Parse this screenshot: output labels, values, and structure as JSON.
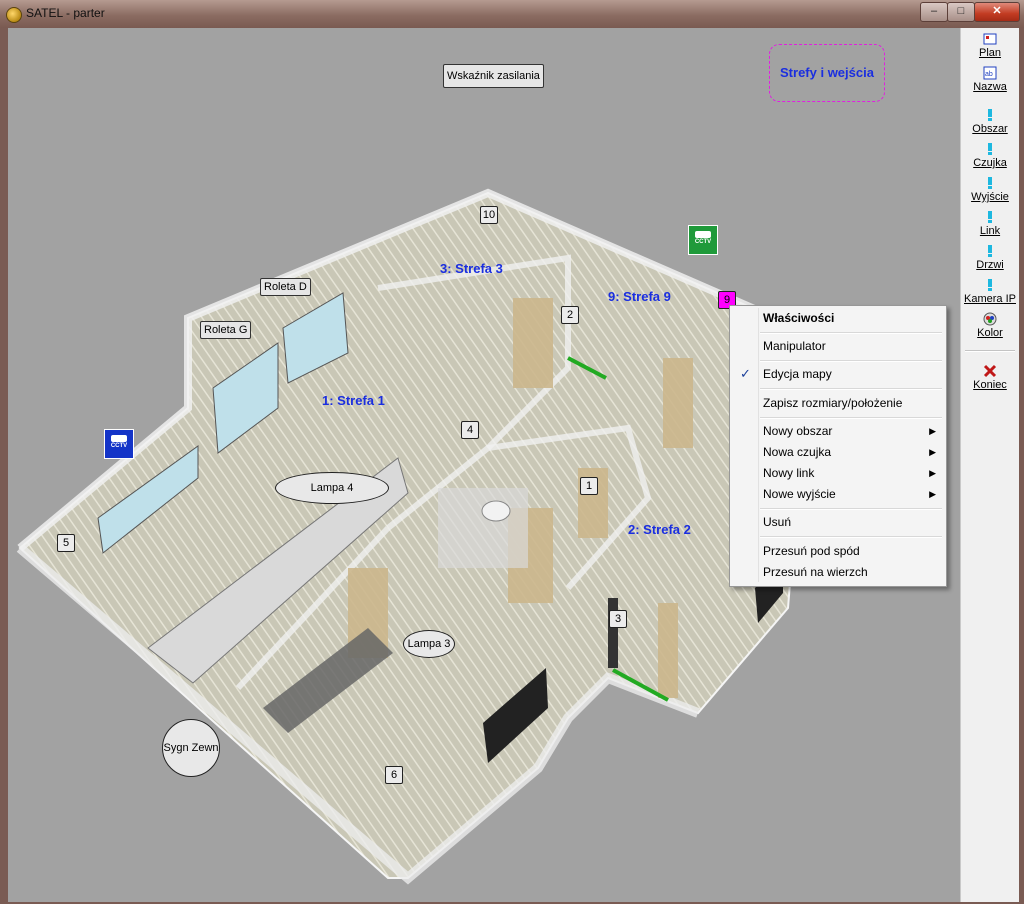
{
  "window": {
    "title": "SATEL - parter",
    "min_label": "–",
    "max_label": "□",
    "close_label": "✕"
  },
  "map": {
    "legend_button": "Strefy i wejścia",
    "power_indicator": "Wskaźnik zasilania",
    "roleta_d": "Roleta D",
    "roleta_g": "Roleta G",
    "zones": [
      {
        "label": "1: Strefa 1"
      },
      {
        "label": "2:  Strefa  2"
      },
      {
        "label": "3: Strefa  3"
      },
      {
        "label": "9: Strefa  9"
      }
    ],
    "numbers": [
      "10",
      "2",
      "9",
      "4",
      "1",
      "5",
      "3",
      "6"
    ],
    "lamp4": "Lampa 4",
    "lamp3": "Lampa 3",
    "siren": "Sygn Zewn",
    "cctv_label": "CCTV",
    "colors": {
      "zone_text": "#1a2ee0",
      "cctv_green": "#1f9a3a",
      "cctv_blue": "#1434c8",
      "alarm_magenta": "#ff00ff",
      "door_green": "#22aa22"
    }
  },
  "toolbar": {
    "items": [
      {
        "label": "Plan",
        "icon": "plan-icon"
      },
      {
        "label": "Nazwa",
        "icon": "name-icon"
      },
      {
        "label": "Obszar",
        "icon": "area-icon"
      },
      {
        "label": "Czujka",
        "icon": "detector-icon"
      },
      {
        "label": "Wyjście",
        "icon": "output-icon"
      },
      {
        "label": "Link",
        "icon": "link-icon"
      },
      {
        "label": "Drzwi",
        "icon": "door-icon"
      },
      {
        "label": "Kamera IP",
        "icon": "camera-icon"
      },
      {
        "label": "Kolor",
        "icon": "color-icon"
      },
      {
        "label": "Koniec",
        "icon": "exit-x-icon"
      }
    ]
  },
  "context_menu": {
    "properties": "Właściwości",
    "manipulator": "Manipulator",
    "edit_map": "Edycja mapy",
    "edit_map_checked": true,
    "save_size": "Zapisz rozmiary/położenie",
    "new_area": "Nowy obszar",
    "new_detector": "Nowa czujka",
    "new_link": "Nowy link",
    "new_output": "Nowe wyjście",
    "delete": "Usuń",
    "send_back": "Przesuń pod spód",
    "bring_front": "Przesuń na wierzch"
  }
}
